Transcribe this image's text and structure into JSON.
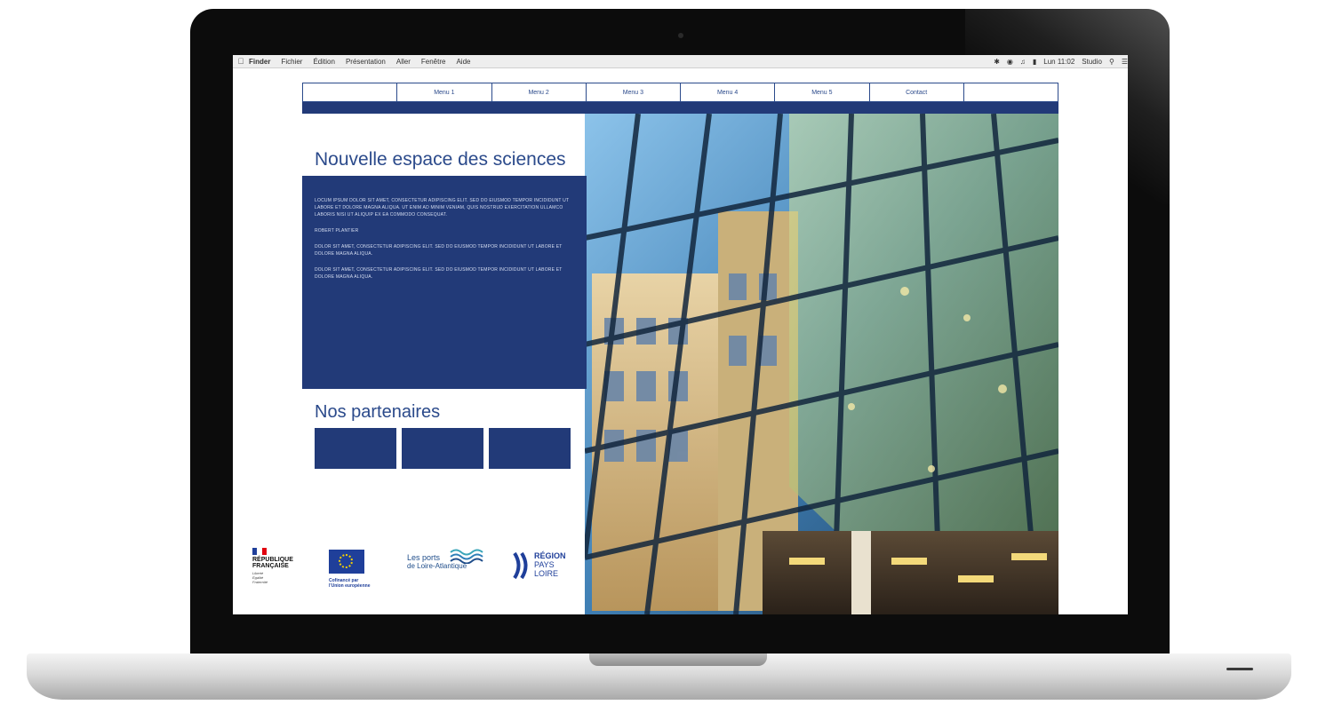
{
  "menubar": {
    "items": [
      "Finder",
      "Fichier",
      "Édition",
      "Présentation",
      "Aller",
      "Fenêtre",
      "Aide"
    ],
    "clock": "Lun 11:02",
    "user": "Studio"
  },
  "nav": {
    "tabs": [
      "",
      "Menu 1",
      "Menu 2",
      "Menu 3",
      "Menu 4",
      "Menu 5",
      "Contact",
      ""
    ]
  },
  "hero": {
    "title": "Nouvelle espace des sciences"
  },
  "textbox": {
    "paragraphs": [
      "LOCUM IPSUM DOLOR SIT AMET, CONSECTETUR ADIPISCING ELIT. SED DO EIUSMOD TEMPOR INCIDIDUNT UT LABORE ET DOLORE MAGNA ALIQUA. UT ENIM AD MINIM VENIAM, QUIS NOSTRUD EXERCITATION ULLAMCO LABORIS NISI UT ALIQUIP EX EA COMMODO CONSEQUAT.",
      "ROBERT PLANTIER",
      "DOLOR SIT AMET, CONSECTETUR ADIPISCING ELIT. SED DO EIUSMOD TEMPOR INCIDIDUNT UT LABORE ET DOLORE MAGNA ALIQUA.",
      "DOLOR SIT AMET, CONSECTETUR ADIPISCING ELIT. SED DO EIUSMOD TEMPOR INCIDIDUNT UT LABORE ET DOLORE MAGNA ALIQUA."
    ]
  },
  "partners": {
    "title": "Nos partenaires"
  },
  "logos": {
    "rf": {
      "line1": "RÉPUBLIQUE",
      "line2": "FRANÇAISE",
      "motto1": "Liberté",
      "motto2": "Égalité",
      "motto3": "Fraternité"
    },
    "eu": {
      "line1": "Cofinancé par",
      "line2": "l'Union européenne"
    },
    "ports": {
      "line1": "Les ports",
      "line2": "de Loire-Atlantique"
    },
    "region": {
      "line1": "RÉGION",
      "line2": "PAYS",
      "line3": "LOIRE"
    }
  },
  "colors": {
    "brand_blue": "#223a78",
    "title_blue": "#2b4a8b"
  }
}
